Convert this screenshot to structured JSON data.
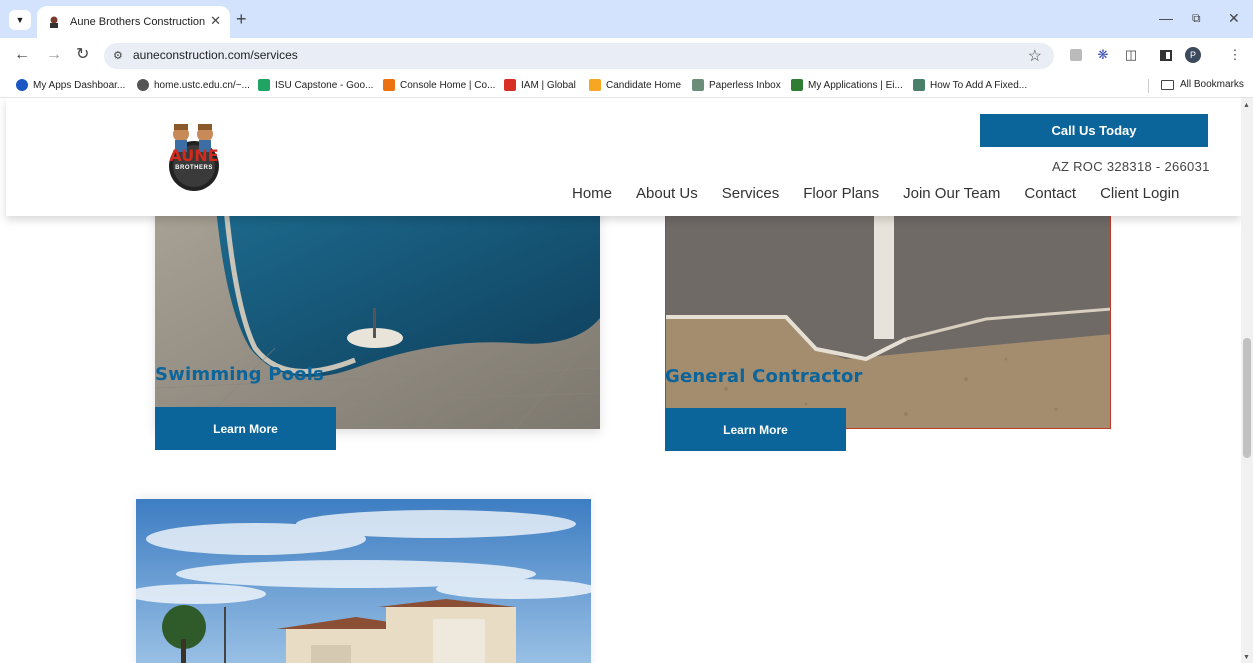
{
  "browser": {
    "tab_title": "Aune Brothers Construction",
    "url": "auneconstruction.com/services",
    "profile_initial": "P",
    "bookmarks": [
      {
        "label": "My Apps Dashboar...",
        "color": "#1a56c4"
      },
      {
        "label": "home.ustc.edu.cn/~...",
        "color": "#555555"
      },
      {
        "label": "ISU Capstone - Goo...",
        "color": "#1fa463"
      },
      {
        "label": "Console Home | Co...",
        "color": "#ec7211"
      },
      {
        "label": "IAM | Global",
        "color": "#d93025"
      },
      {
        "label": "Candidate Home",
        "color": "#f5a623"
      },
      {
        "label": "Paperless Inbox",
        "color": "#6b8e7a"
      },
      {
        "label": "My Applications | Ei...",
        "color": "#2e7d32"
      },
      {
        "label": "How To Add A Fixed...",
        "color": "#4a7f6a"
      }
    ],
    "all_bookmarks_label": "All Bookmarks"
  },
  "site": {
    "logo_text": "AUNE",
    "logo_subtext": "BROTHERS",
    "call_button": "Call Us Today",
    "license": "AZ ROC 328318 - 266031",
    "nav": [
      "Home",
      "About Us",
      "Services",
      "Floor Plans",
      "Join Our Team",
      "Contact",
      "Client Login"
    ]
  },
  "services": [
    {
      "title": "Swimming Pools",
      "button": "Learn More"
    },
    {
      "title": "General Contractor",
      "button": "Learn More"
    }
  ],
  "colors": {
    "brand_blue": "#0b659b",
    "tabstrip": "#d3e3fd"
  }
}
